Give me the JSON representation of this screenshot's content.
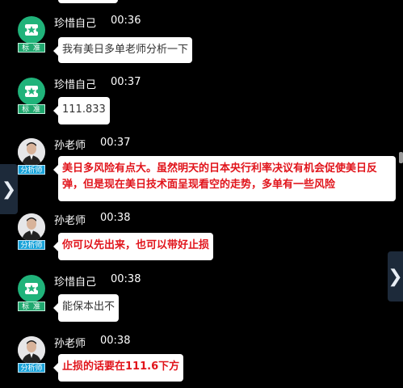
{
  "messages": [
    {
      "sender": "珍惜自己",
      "time": "00:36",
      "role": "标 准",
      "text": "我有美日多单老师分析一下",
      "style": "normal"
    },
    {
      "sender": "珍惜自己",
      "time": "00:37",
      "role": "标 准",
      "text": "111.833",
      "style": "normal"
    },
    {
      "sender": "孙老师",
      "time": "00:37",
      "role": "分析师",
      "text_line1": "美日多风险有点大。虽然明天的日本央行利率决议有机会促使美日反",
      "text_line2": "弹，但是现在美日技术面呈现看空的走势，多单有一些风险",
      "style": "alert"
    },
    {
      "sender": "孙老师",
      "time": "00:38",
      "role": "分析师",
      "text": "你可以先出来，也可以带好止损",
      "style": "alert"
    },
    {
      "sender": "珍惜自己",
      "time": "00:38",
      "role": "标 准",
      "text": "能保本出不",
      "style": "normal"
    },
    {
      "sender": "孙老师",
      "time": "00:38",
      "role": "分析师",
      "text": "止损的话要在111.6下方",
      "style": "alert"
    }
  ],
  "nav": {
    "left_arrow": "❯",
    "right_arrow": "❯"
  },
  "icons": {
    "user_avatar": "ticket-star-icon",
    "analyst_avatar": "analyst-photo-avatar"
  },
  "colors": {
    "background": "#000000",
    "alert_text": "#e1141b",
    "standard_badge": "#20a86f",
    "analyst_badge": "#1aa3d9"
  }
}
